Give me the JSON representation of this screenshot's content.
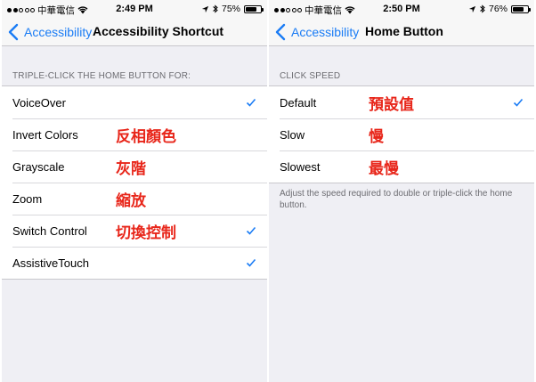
{
  "left": {
    "status": {
      "carrier": "中華電信",
      "time": "2:49 PM",
      "battery_text": "75%",
      "battery_level": 0.75
    },
    "nav": {
      "back_label": "Accessibility",
      "title": "Accessibility Shortcut"
    },
    "section_header": "TRIPLE-CLICK THE HOME BUTTON FOR:",
    "items": [
      {
        "label": "VoiceOver",
        "annotation": "",
        "checked": true
      },
      {
        "label": "Invert Colors",
        "annotation": "反相顏色",
        "checked": false
      },
      {
        "label": "Grayscale",
        "annotation": "灰階",
        "checked": false
      },
      {
        "label": "Zoom",
        "annotation": "縮放",
        "checked": false
      },
      {
        "label": "Switch Control",
        "annotation": "切換控制",
        "checked": true
      },
      {
        "label": "AssistiveTouch",
        "annotation": "",
        "checked": true
      }
    ]
  },
  "right": {
    "status": {
      "carrier": "中華電信",
      "time": "2:50 PM",
      "battery_text": "76%",
      "battery_level": 0.76
    },
    "nav": {
      "back_label": "Accessibility",
      "title": "Home Button"
    },
    "section_header": "CLICK SPEED",
    "items": [
      {
        "label": "Default",
        "annotation": "預設值",
        "checked": true
      },
      {
        "label": "Slow",
        "annotation": "慢",
        "checked": false
      },
      {
        "label": "Slowest",
        "annotation": "最慢",
        "checked": false
      }
    ],
    "footer": "Adjust the speed required to double or triple-click the home button."
  },
  "colors": {
    "tint": "#1a7cf5",
    "annotation": "#e8261a",
    "group_bg": "#efeff4",
    "header_text": "#6d6d72"
  }
}
